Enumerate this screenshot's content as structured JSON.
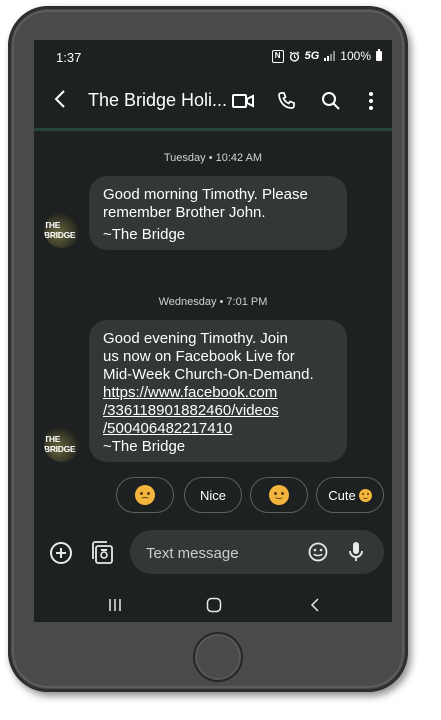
{
  "status_bar": {
    "time": "1:37",
    "nfc": "N",
    "network": "5G",
    "battery": "100%"
  },
  "header": {
    "title": "The Bridge Holi...",
    "icons": [
      "back-arrow-icon",
      "video-call-icon",
      "phone-icon",
      "search-icon",
      "more-vert-icon"
    ]
  },
  "messages": [
    {
      "timestamp": "Tuesday • 10:42 AM",
      "sender_avatar_text": "THE BRIDGE",
      "lines": [
        "Good morning Timothy. Please",
        "remember Brother John."
      ],
      "signature": "~The Bridge"
    },
    {
      "timestamp": "Wednesday • 7:01 PM",
      "sender_avatar_text": "THE BRIDGE",
      "lines": [
        "Good evening Timothy. Join",
        "us now on Facebook Live for",
        "Mid-Week Church-On-Demand."
      ],
      "link_lines": [
        "https://www.facebook.com",
        "/336118901882460/videos",
        "/500406482217410"
      ],
      "signature": "~The Bridge"
    }
  ],
  "smart_replies": [
    {
      "label": "",
      "icon": "worried-face-emoji"
    },
    {
      "label": "Nice",
      "icon": ""
    },
    {
      "label": "",
      "icon": "smiling-face-emoji"
    },
    {
      "label": "Cute",
      "icon": "smiling-face-emoji"
    }
  ],
  "compose": {
    "placeholder": "Text message",
    "icons": [
      "add-circle-icon",
      "gallery-icon",
      "emoji-icon",
      "mic-icon"
    ]
  },
  "nav_bar": {
    "icons": [
      "recent-apps-icon",
      "home-icon",
      "back-icon"
    ]
  },
  "colors": {
    "screen_bg": "#1d2121",
    "bubble_bg": "#323737",
    "device_frame": "#4a4a4a",
    "emoji": "#f3b53b"
  }
}
